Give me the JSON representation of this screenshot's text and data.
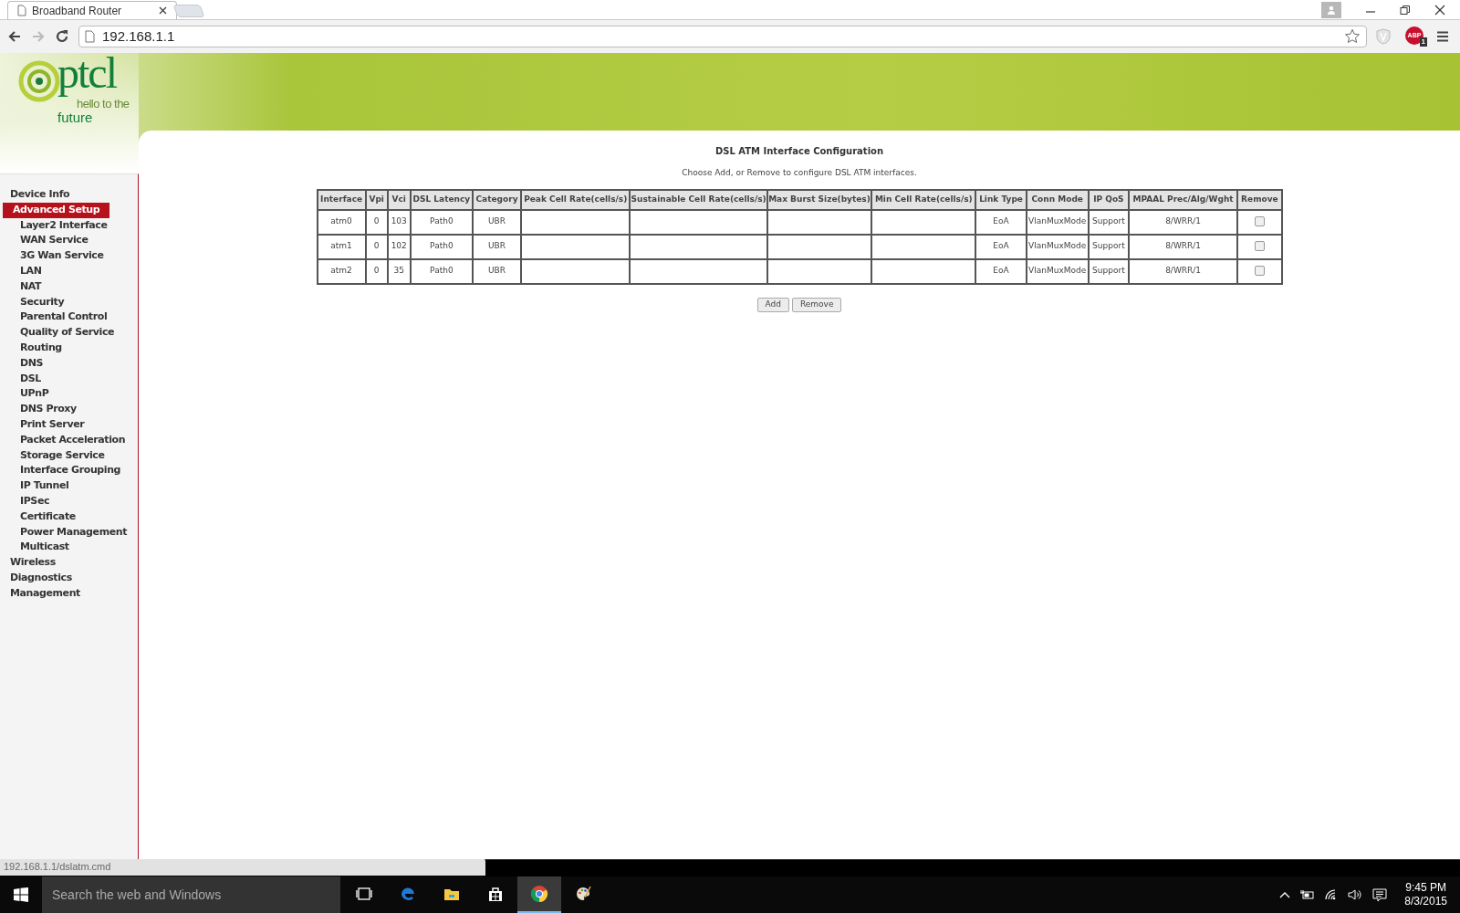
{
  "browser": {
    "tabs": [
      {
        "title": "Broadband Router",
        "selected": true
      }
    ],
    "address": "192.168.1.1",
    "abp_label": "ABP",
    "abp_badge": "1",
    "status_url": "192.168.1.1/dslatm.cmd"
  },
  "logo": {
    "name": "ptcl",
    "tagline_1": "hello to the",
    "tagline_2": "future"
  },
  "sidebar": {
    "items": [
      {
        "label": "Device Info",
        "selected": false
      },
      {
        "label": "Advanced Setup",
        "selected": true,
        "children": [
          {
            "label": "Layer2 Interface",
            "selected": false
          },
          {
            "label": "WAN Service",
            "selected": false
          },
          {
            "label": "3G Wan Service",
            "selected": false
          },
          {
            "label": "LAN",
            "selected": false
          },
          {
            "label": "NAT",
            "selected": false
          },
          {
            "label": "Security",
            "selected": false
          },
          {
            "label": "Parental Control",
            "selected": false
          },
          {
            "label": "Quality of Service",
            "selected": false
          },
          {
            "label": "Routing",
            "selected": false
          },
          {
            "label": "DNS",
            "selected": false
          },
          {
            "label": "DSL",
            "selected": false
          },
          {
            "label": "UPnP",
            "selected": false
          },
          {
            "label": "DNS Proxy",
            "selected": false
          },
          {
            "label": "Print Server",
            "selected": false
          },
          {
            "label": "Packet Acceleration",
            "selected": false
          },
          {
            "label": "Storage Service",
            "selected": false
          },
          {
            "label": "Interface Grouping",
            "selected": false
          },
          {
            "label": "IP Tunnel",
            "selected": false
          },
          {
            "label": "IPSec",
            "selected": false
          },
          {
            "label": "Certificate",
            "selected": false
          },
          {
            "label": "Power Management",
            "selected": false
          },
          {
            "label": "Multicast",
            "selected": false
          }
        ]
      },
      {
        "label": "Wireless",
        "selected": false
      },
      {
        "label": "Diagnostics",
        "selected": false
      },
      {
        "label": "Management",
        "selected": false
      }
    ]
  },
  "page": {
    "title": "DSL ATM Interface Configuration",
    "subtitle": "Choose Add, or Remove to configure DSL ATM interfaces.",
    "table": {
      "columns": [
        "Interface",
        "Vpi",
        "Vci",
        "DSL Latency",
        "Category",
        "Peak Cell Rate(cells/s)",
        "Sustainable Cell Rate(cells/s)",
        "Max Burst Size(bytes)",
        "Min Cell Rate(cells/s)",
        "Link Type",
        "Conn Mode",
        "IP QoS",
        "MPAAL Prec/Alg/Wght",
        "Remove"
      ],
      "rows": [
        {
          "interface": "atm0",
          "vpi": "0",
          "vci": "103",
          "dsl_latency": "Path0",
          "category": "UBR",
          "link_type": "EoA",
          "conn_mode": "VlanMuxMode",
          "ip_qos": "Support",
          "mpaal": "8/WRR/1",
          "remove_checked": false
        },
        {
          "interface": "atm1",
          "vpi": "0",
          "vci": "102",
          "dsl_latency": "Path0",
          "category": "UBR",
          "link_type": "EoA",
          "conn_mode": "VlanMuxMode",
          "ip_qos": "Support",
          "mpaal": "8/WRR/1",
          "remove_checked": false
        },
        {
          "interface": "atm2",
          "vpi": "0",
          "vci": "35",
          "dsl_latency": "Path0",
          "category": "UBR",
          "link_type": "EoA",
          "conn_mode": "VlanMuxMode",
          "ip_qos": "Support",
          "mpaal": "8/WRR/1",
          "remove_checked": false
        }
      ]
    },
    "buttons": [
      "Add",
      "Remove"
    ]
  },
  "taskbar": {
    "search_placeholder": "Search the web and Windows",
    "apps": [
      {
        "kind": "taskview",
        "selected": false
      },
      {
        "kind": "edge",
        "selected": false
      },
      {
        "kind": "explorer",
        "selected": false
      },
      {
        "kind": "store",
        "selected": false
      },
      {
        "kind": "chrome",
        "selected": true
      },
      {
        "kind": "paint",
        "selected": false
      }
    ],
    "clock": {
      "time": "9:45 PM",
      "date": "8/3/2015"
    }
  }
}
